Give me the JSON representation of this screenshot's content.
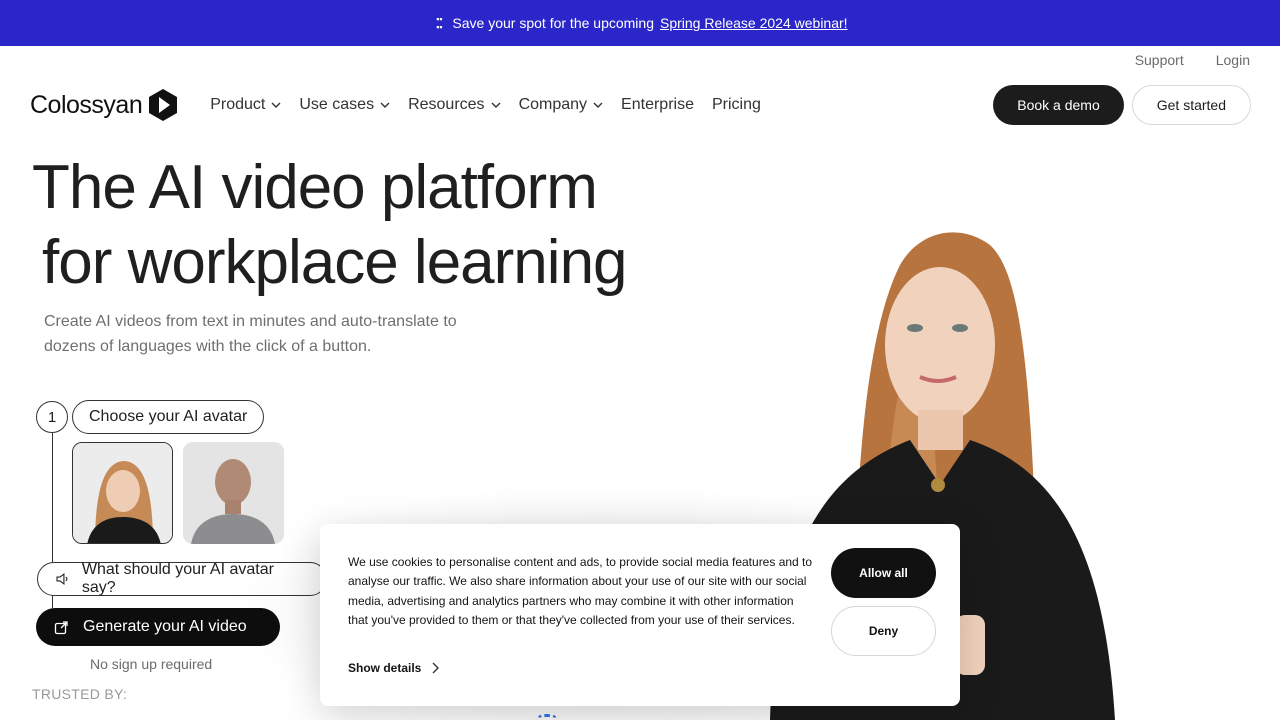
{
  "banner": {
    "icon": "calendar-icon",
    "text": "Save your spot for the upcoming",
    "link": "Spring Release 2024 webinar!",
    "bg_color": "#2a26c9"
  },
  "toplinks": {
    "support": "Support",
    "login": "Login"
  },
  "nav": {
    "logo_text": "Colossyan",
    "items": [
      {
        "label": "Product",
        "dropdown": true
      },
      {
        "label": "Use cases",
        "dropdown": true
      },
      {
        "label": "Resources",
        "dropdown": true
      },
      {
        "label": "Company",
        "dropdown": true
      },
      {
        "label": "Enterprise",
        "dropdown": false
      },
      {
        "label": "Pricing",
        "dropdown": false
      }
    ],
    "book_demo": "Book a demo",
    "get_started": "Get started"
  },
  "hero": {
    "title_line1": "The AI video platform",
    "title_line2": "for workplace learning",
    "subtitle": "Create AI videos from text in minutes and auto-translate to dozens of languages with the click of a button."
  },
  "builder": {
    "step_number": "1",
    "step_label": "Choose your AI avatar",
    "say_label": "What should your AI avatar say?",
    "generate_label": "Generate your AI video",
    "no_signup": "No sign up required"
  },
  "trusted_label": "TRUSTED BY:",
  "cookie": {
    "text": "We use cookies to personalise content and ads, to provide social media features and to analyse our traffic. We also share information about your use of our site with our social media, advertising and analytics partners who may combine it with other information that you've provided to them or that they've collected from your use of their services.",
    "show_details": "Show details",
    "allow_all": "Allow all",
    "deny": "Deny"
  }
}
